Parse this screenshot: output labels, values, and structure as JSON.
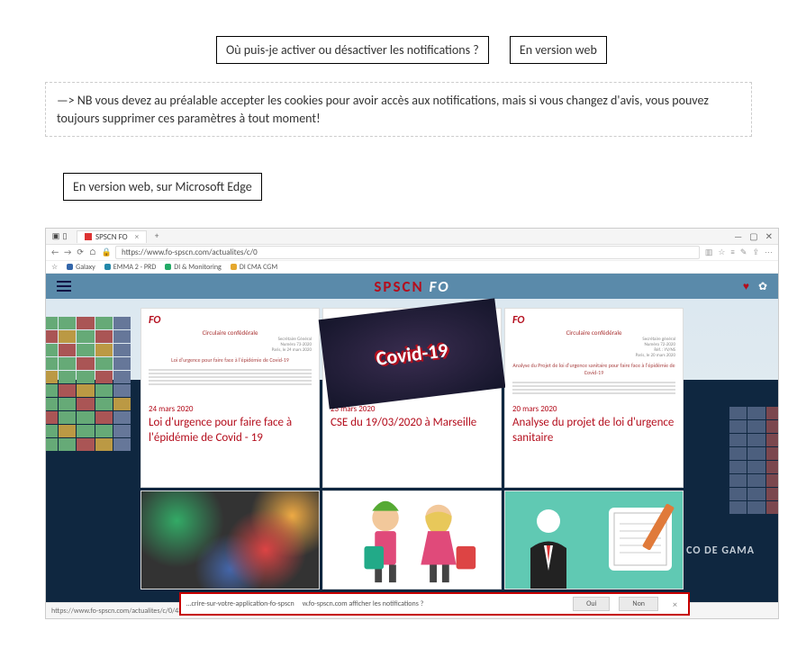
{
  "title": "Où puis-je activer ou désactiver les notifications ?",
  "subtitle1": "En version web",
  "nb": "—> NB vous devez au préalable accepter les cookies pour avoir accès aux notifications, mais si vous changez d'avis, vous pouvez toujours supprimer ces paramètres à tout moment!",
  "subtitle2": "En version web, sur Microsoft Edge",
  "browser": {
    "tab_label": "SPSCN FO",
    "tab_add": "+",
    "url": "https://www.fo-spscn.com/actualites/c/0",
    "bookmarks": {
      "b1": "Galaxy",
      "b2": "EMMA 2 - PRD",
      "b3": "DI & Monitoring",
      "b4": "DI CMA CGM"
    },
    "addr_icons": {
      "back": "←",
      "forward": "→",
      "reload": "⟳",
      "home": "⌂",
      "lock": "🔒"
    },
    "status_url": "https://www.fo-spscn.com/actualites/c/0/437712/1/pourquoi-vous-inscrire-sur-votre-application-fo-spscn",
    "winbtns": {
      "min": "—",
      "max": "▢",
      "close": "✕"
    }
  },
  "site": {
    "brand_left": "SPSCN",
    "brand_right": "FO",
    "hull_text": "CO DE GAMA",
    "cards": [
      {
        "doc_header": "Circulaire confédérale",
        "doc_sub": "Secrétaire Général\nNuméro 73-2020\nParis, le 24 mars 2020",
        "doc_line": "Loi d'urgence pour faire face à l'épidémie de Covid-19",
        "date": "24 mars 2020",
        "title": "Loi d'urgence pour faire face à l'épidémie de Covid - 19"
      },
      {
        "covid": "Covid-19",
        "date": "23 mars 2020",
        "title": "CSE du 19/03/2020 à Marseille"
      },
      {
        "doc_header": "Circulaire confédérale",
        "doc_sub": "Secrétaire général\nNuméro 72-2020\nRéf. : YV/NS\nParis, le 20 mars 2020",
        "doc_line": "Analyse du Projet de loi d'urgence sanitaire pour faire face à l'épidémie de Covid-19",
        "date": "20 mars 2020",
        "title": "Analyse du projet de loi d'urgence sanitaire"
      }
    ]
  },
  "notif": {
    "text_left": "…crire-sur-votre-application-fo-spscn",
    "text_mid": "w.fo-spscn.com afficher les notifications ?",
    "btn_yes": "Oui",
    "btn_no": "Non",
    "close": "×"
  }
}
